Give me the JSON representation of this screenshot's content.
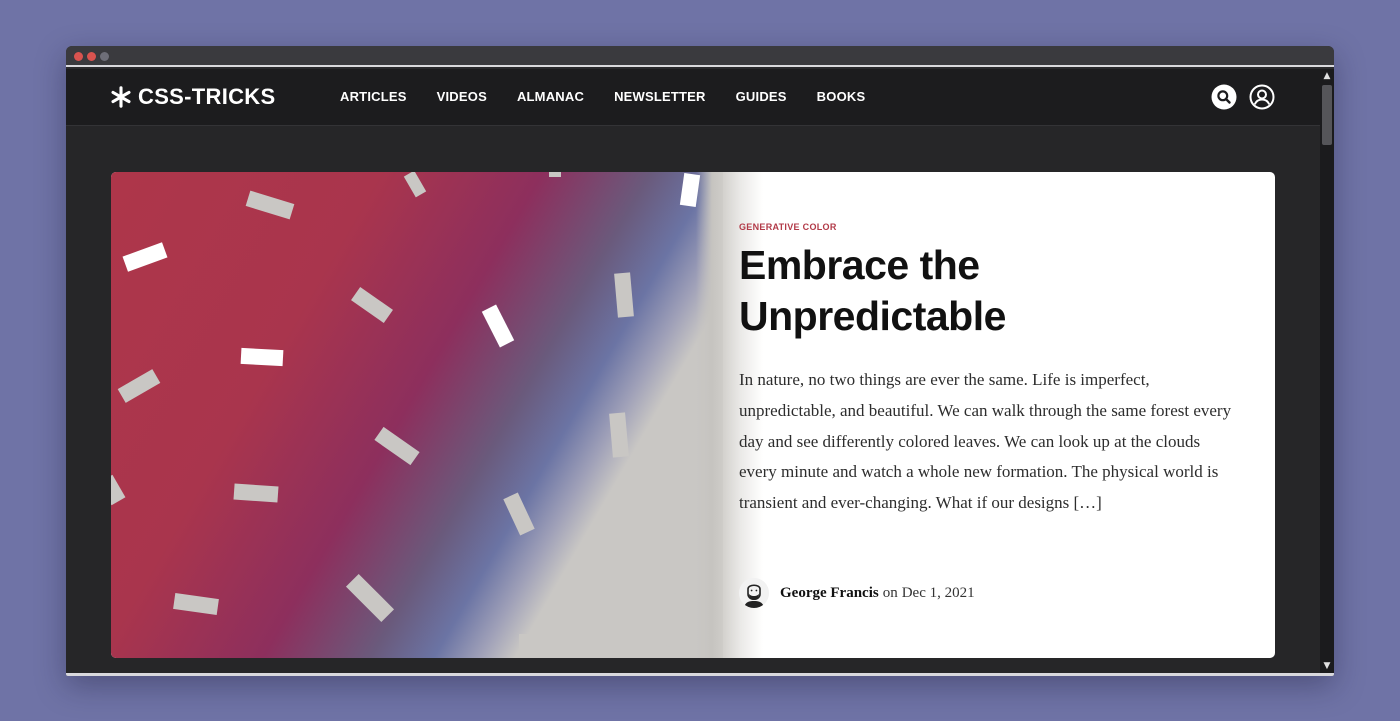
{
  "site": {
    "logo_text": "CSS-TRICKS",
    "nav": [
      "ARTICLES",
      "VIDEOS",
      "ALMANAC",
      "NEWSLETTER",
      "GUIDES",
      "BOOKS"
    ],
    "icons": {
      "search": "search-icon",
      "account": "user-icon",
      "logo": "asterisk-icon"
    }
  },
  "featured": {
    "category": "GENERATIVE COLOR",
    "title": "Embrace the Unpredictable",
    "excerpt": "In nature, no two things are ever the same. Life is imperfect, unpredictable, and beautiful. We can walk through the same forest every day and see differently colored leaves. We can look up at the clouds every minute and watch a whole new formation. The physical world is transient and ever-changing. What if our designs […]",
    "author": "George Francis",
    "byline_on": "on",
    "date": "Dec 1, 2021"
  },
  "colors": {
    "page_bg": "#6f73a6",
    "accent": "#b23a48",
    "nav_bg": "#1c1c1e",
    "hero_red": "#ae364a",
    "hero_purple": "#8d2f5d",
    "hero_blue": "#6b74a4"
  }
}
